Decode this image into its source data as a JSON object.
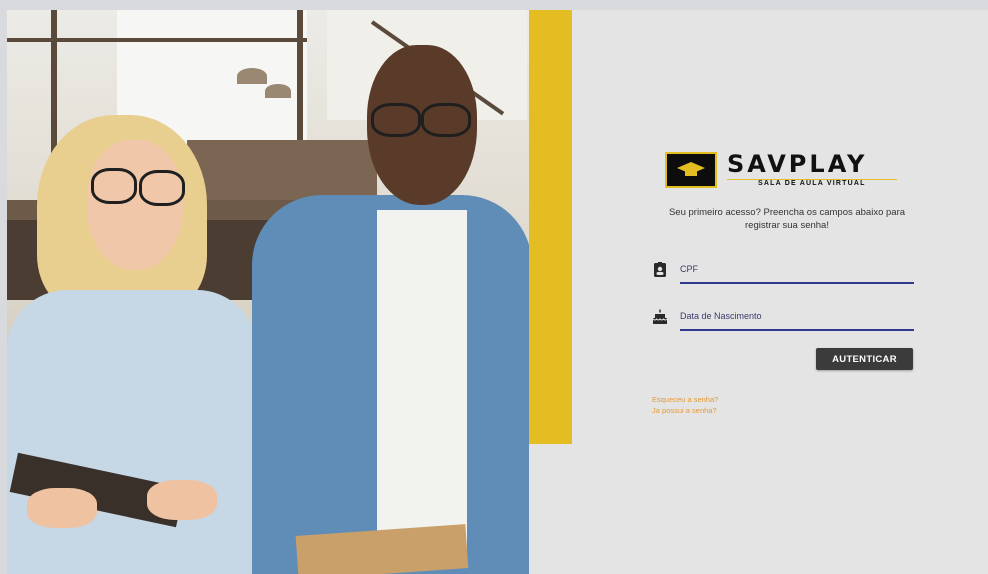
{
  "brand": {
    "title": "SAVPLAY",
    "subtitle": "SALA DE AULA VIRTUAL",
    "accent": "#e3bd22"
  },
  "login": {
    "intro_text": "Seu primeiro acesso? Preencha os campos abaixo para registrar sua senha!",
    "fields": [
      {
        "label": "CPF",
        "icon": "id-badge-icon"
      },
      {
        "label": "Data de Nascimento",
        "icon": "cake-icon"
      }
    ],
    "submit_label": "AUTENTICAR",
    "links": [
      {
        "label": "Esqueceu a senha?"
      },
      {
        "label": "Ja possui a senha?"
      }
    ]
  },
  "colors": {
    "field_underline": "#2f3a8f",
    "button_bg": "#3b3b3b",
    "link": "#e39a36"
  }
}
